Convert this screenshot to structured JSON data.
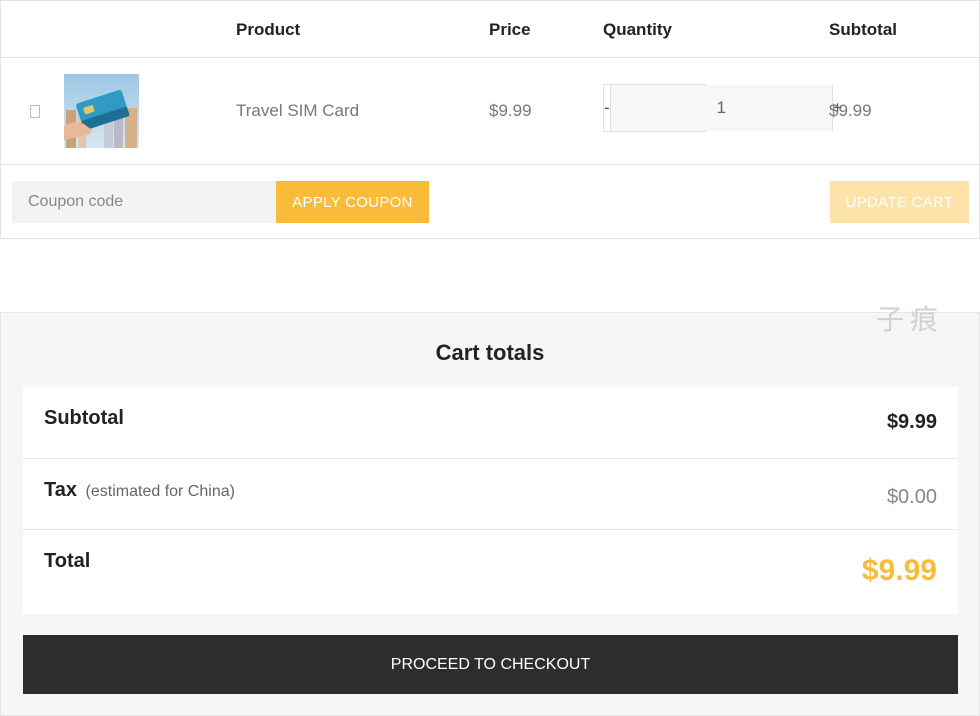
{
  "table": {
    "headers": {
      "product": "Product",
      "price": "Price",
      "quantity": "Quantity",
      "subtotal": "Subtotal"
    },
    "items": [
      {
        "name": "Travel SIM Card",
        "price": "$9.99",
        "quantity": "1",
        "subtotal": "$9.99",
        "thumbnail_icon": "sim-card-thumbnail"
      }
    ],
    "qty_minus": "-",
    "qty_plus": "+"
  },
  "coupon": {
    "placeholder": "Coupon code",
    "apply_label": "APPLY COUPON"
  },
  "update_label": "UPDATE CART",
  "totals": {
    "title": "Cart totals",
    "subtotal_label": "Subtotal",
    "subtotal_value": "$9.99",
    "tax_label": "Tax",
    "tax_note": "(estimated for China)",
    "tax_value": "$0.00",
    "total_label": "Total",
    "total_value": "$9.99"
  },
  "checkout_label": "PROCEED TO CHECKOUT",
  "watermark": "子痕",
  "colors": {
    "accent": "#fbbb3a",
    "accent_disabled": "#fde3a9",
    "checkout_bg": "#2d2d2d",
    "totals_bg": "#f6f6f6"
  }
}
